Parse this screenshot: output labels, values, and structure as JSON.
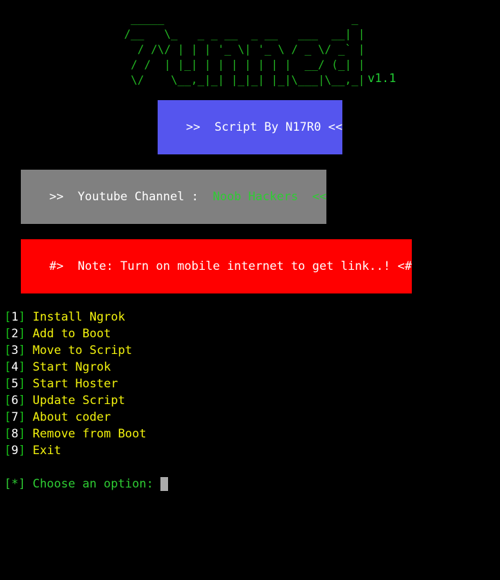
{
  "terminal": {
    "background": "#000000",
    "logo": {
      "art_lines": [
        "    _____                            _",
        "   /__   \\_   _ _ __  _ __   ___  __| |",
        "     / /\\/ | | | '_ \\| '_ \\ / _ \\/ _` |",
        "    / /  | |_| | | | | | | |  __/ (_| |",
        "    \\/    \\__,_|_| |_|_| |_|\\___|\\__,_|",
        ""
      ],
      "version": "v1.1",
      "color": "#22b522",
      "version_color": "#22cc33"
    },
    "banners": [
      {
        "name": "script-author",
        "background": "#5555ee",
        "text_color": "#ffffff",
        "segments": [
          {
            "text": ">>  Script By N17R0 <<",
            "color": "#ffffff"
          }
        ]
      },
      {
        "name": "youtube-channel",
        "background": "#808080",
        "text_color": "#ffffff",
        "segments": [
          {
            "text": ">>  Youtube Channel :  ",
            "color": "#ffffff"
          },
          {
            "text": "Noob Hackers  <<",
            "color": "#2ecc33"
          }
        ]
      },
      {
        "name": "note",
        "background": "#ff0000",
        "text_color": "#ffffff",
        "segments": [
          {
            "text": "#>  Note: Turn on mobile internet to get link..! <#",
            "color": "#ffffff"
          }
        ]
      }
    ],
    "menu": {
      "bracket_color": "#18c018",
      "number_color": "#ffffff",
      "label_color": "#f2f20d",
      "items": [
        {
          "number": "1",
          "label": "Install Ngrok"
        },
        {
          "number": "2",
          "label": "Add to Boot"
        },
        {
          "number": "3",
          "label": "Move to Script"
        },
        {
          "number": "4",
          "label": "Start Ngrok"
        },
        {
          "number": "5",
          "label": "Start Hoster"
        },
        {
          "number": "6",
          "label": "Update Script"
        },
        {
          "number": "7",
          "label": "About coder"
        },
        {
          "number": "8",
          "label": "Remove from Boot"
        },
        {
          "number": "9",
          "label": "Exit"
        }
      ]
    },
    "prompt": {
      "marker": "[*]",
      "text": " Choose an option: ",
      "color": "#2ecc33",
      "cursor_color": "#aaaaaa",
      "input_value": ""
    }
  }
}
